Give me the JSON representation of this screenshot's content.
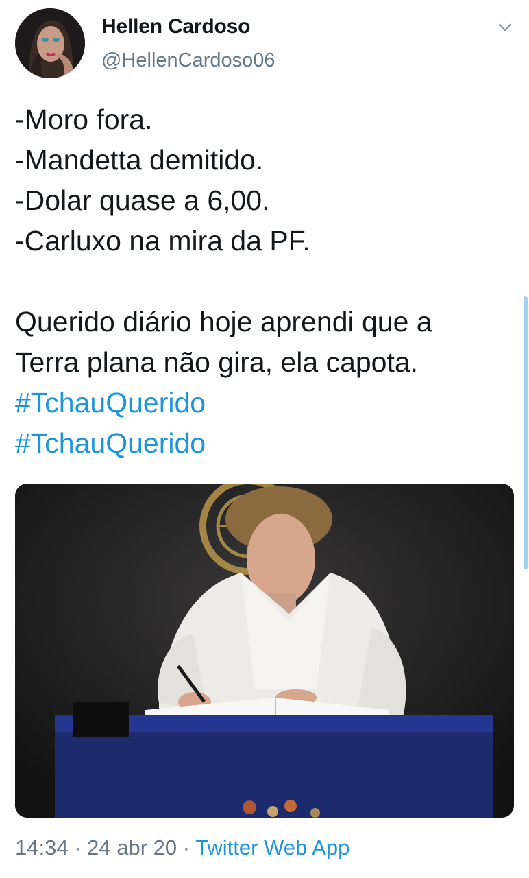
{
  "tweet": {
    "display_name": "Hellen Cardoso",
    "handle": "@HellenCardoso06",
    "lines": [
      "-Moro fora.",
      "-Mandetta demitido.",
      "-Dolar quase a 6,00.",
      "-Carluxo na mira da PF."
    ],
    "paragraph": [
      "Querido diário hoje aprendi que a",
      "Terra plana não gira, ela capota."
    ],
    "hashtags": [
      "#TchauQuerido",
      "#TchauQuerido"
    ],
    "time": "14:34",
    "separator": "·",
    "date": "24 abr 20",
    "source": "Twitter Web App"
  },
  "icons": {
    "menu": "chevron-down-icon"
  },
  "colors": {
    "link": "#1b95e0",
    "secondary_text": "#657786",
    "primary_text": "#14171a"
  }
}
